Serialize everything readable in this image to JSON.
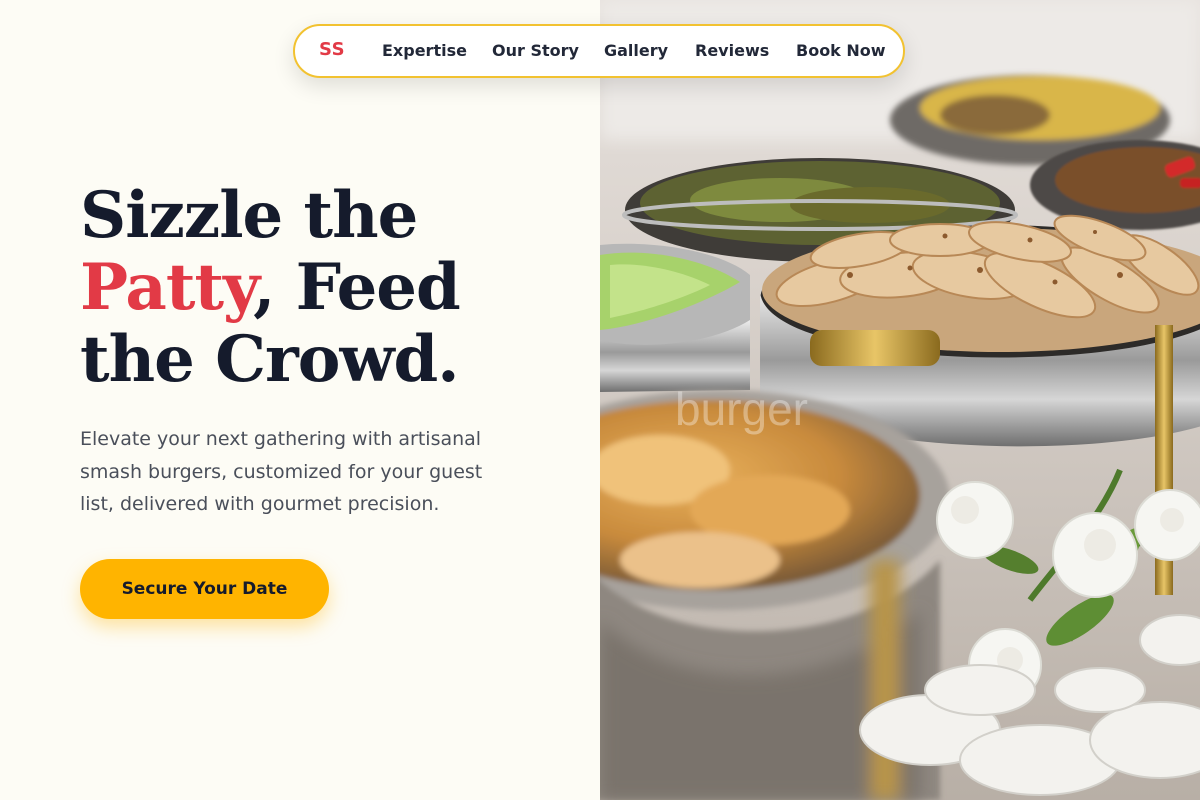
{
  "nav": {
    "logo": "SS",
    "items": [
      {
        "label": "Expertise"
      },
      {
        "label": "Our Story"
      },
      {
        "label": "Gallery"
      },
      {
        "label": "Reviews"
      },
      {
        "label": "Book Now"
      }
    ]
  },
  "hero": {
    "headline_line1": "Sizzle the",
    "headline_accent": "Patty",
    "headline_line2_rest": ", Feed",
    "headline_line3": "the Crowd.",
    "subtext": "Elevate your next gathering with artisanal smash burgers, customized for your guest list, delivered with gourmet precision.",
    "cta_label": "Secure Your Date"
  },
  "photo": {
    "watermark": "burger"
  },
  "colors": {
    "accent": "#E23A46",
    "cta": "#FFB400",
    "nav_border": "#F2C230",
    "ink": "#151B2C",
    "background": "#FDFCF5"
  }
}
